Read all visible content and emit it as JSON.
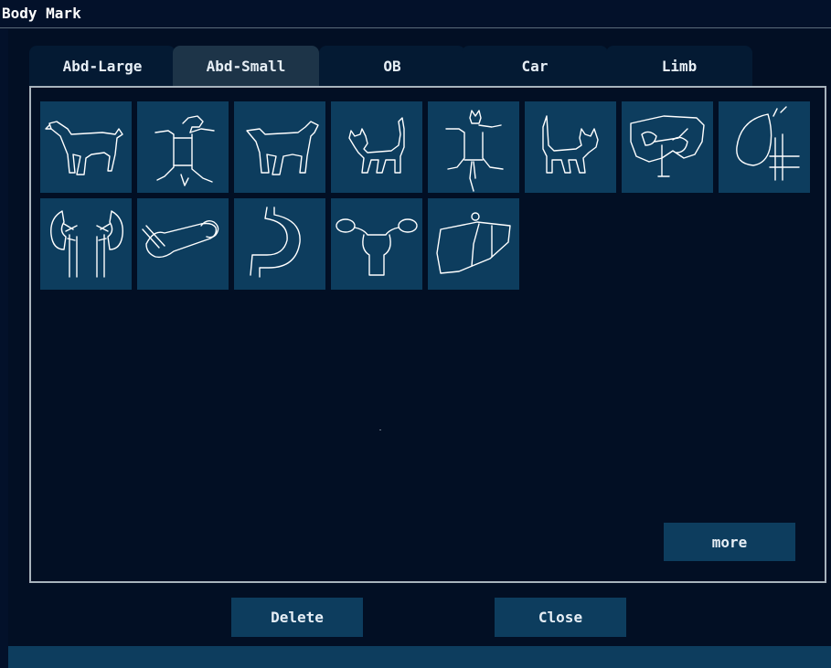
{
  "window": {
    "title": "Body Mark"
  },
  "tabs": [
    {
      "label": "Abd-Large",
      "active": false
    },
    {
      "label": "Abd-Small",
      "active": true
    },
    {
      "label": "OB",
      "active": false
    },
    {
      "label": "Car",
      "active": false
    },
    {
      "label": "Limb",
      "active": false
    }
  ],
  "body_marks": [
    {
      "icon": "dog-side-icon"
    },
    {
      "icon": "dog-supine-icon"
    },
    {
      "icon": "dog-side-icon"
    },
    {
      "icon": "cat-side-icon"
    },
    {
      "icon": "cat-supine-icon"
    },
    {
      "icon": "cat-side-right-icon"
    },
    {
      "icon": "abdominal-organs-icon"
    },
    {
      "icon": "bladder-icon"
    },
    {
      "icon": "kidneys-icon"
    },
    {
      "icon": "pancreas-icon"
    },
    {
      "icon": "stomach-icon"
    },
    {
      "icon": "uterus-icon"
    },
    {
      "icon": "liver-icon"
    }
  ],
  "buttons": {
    "more": "more",
    "delete": "Delete",
    "close": "Close"
  },
  "colors": {
    "background": "#03112a",
    "tile": "#0d3d5e",
    "active_tab": "#1d3448",
    "text": "#e6eef5"
  }
}
